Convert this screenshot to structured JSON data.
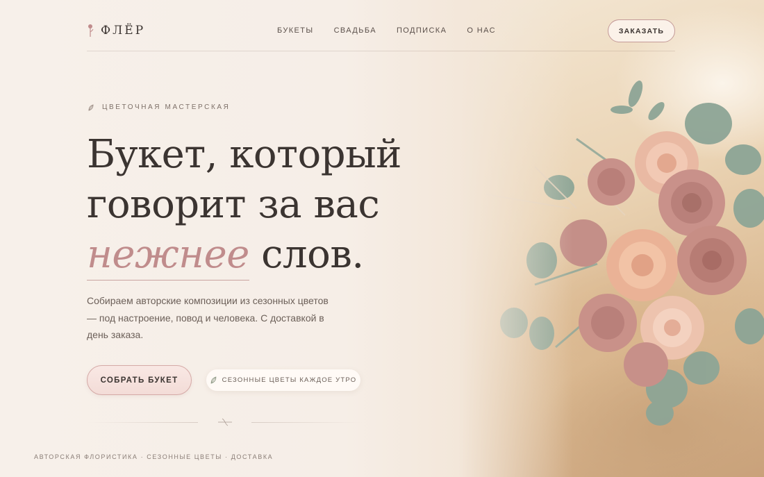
{
  "brand": {
    "name": "ФЛЁР",
    "logo_icon": "stem-icon",
    "accent_color": "#c08c8c"
  },
  "nav": {
    "items": [
      {
        "label": "БУКЕТЫ"
      },
      {
        "label": "СВАДЬБА"
      },
      {
        "label": "ПОДПИСКА"
      },
      {
        "label": "О НАС"
      }
    ],
    "order_button": "ЗАКАЗАТЬ"
  },
  "hero": {
    "eyebrow": "ЦВЕТОЧНАЯ МАСТЕРСКАЯ",
    "headline_line1": "Букет, который",
    "headline_line2": "говорит за вас",
    "headline_accent": "нежнее",
    "headline_tail": " слов.",
    "lead": "Собираем авторские композиции из сезонных цветов — под настроение, повод и человека. С доставкой в день заказа.",
    "cta_label": "СОБРАТЬ БУКЕТ",
    "badge_label": "СЕЗОННЫЕ ЦВЕТЫ КАЖДОЕ УТРО"
  },
  "footer": {
    "tagline": "АВТОРСКАЯ ФЛОРИСТИКА · СЕЗОННЫЕ ЦВЕТЫ · ДОСТАВКА"
  },
  "image": {
    "subject": "bouquet-photo"
  }
}
